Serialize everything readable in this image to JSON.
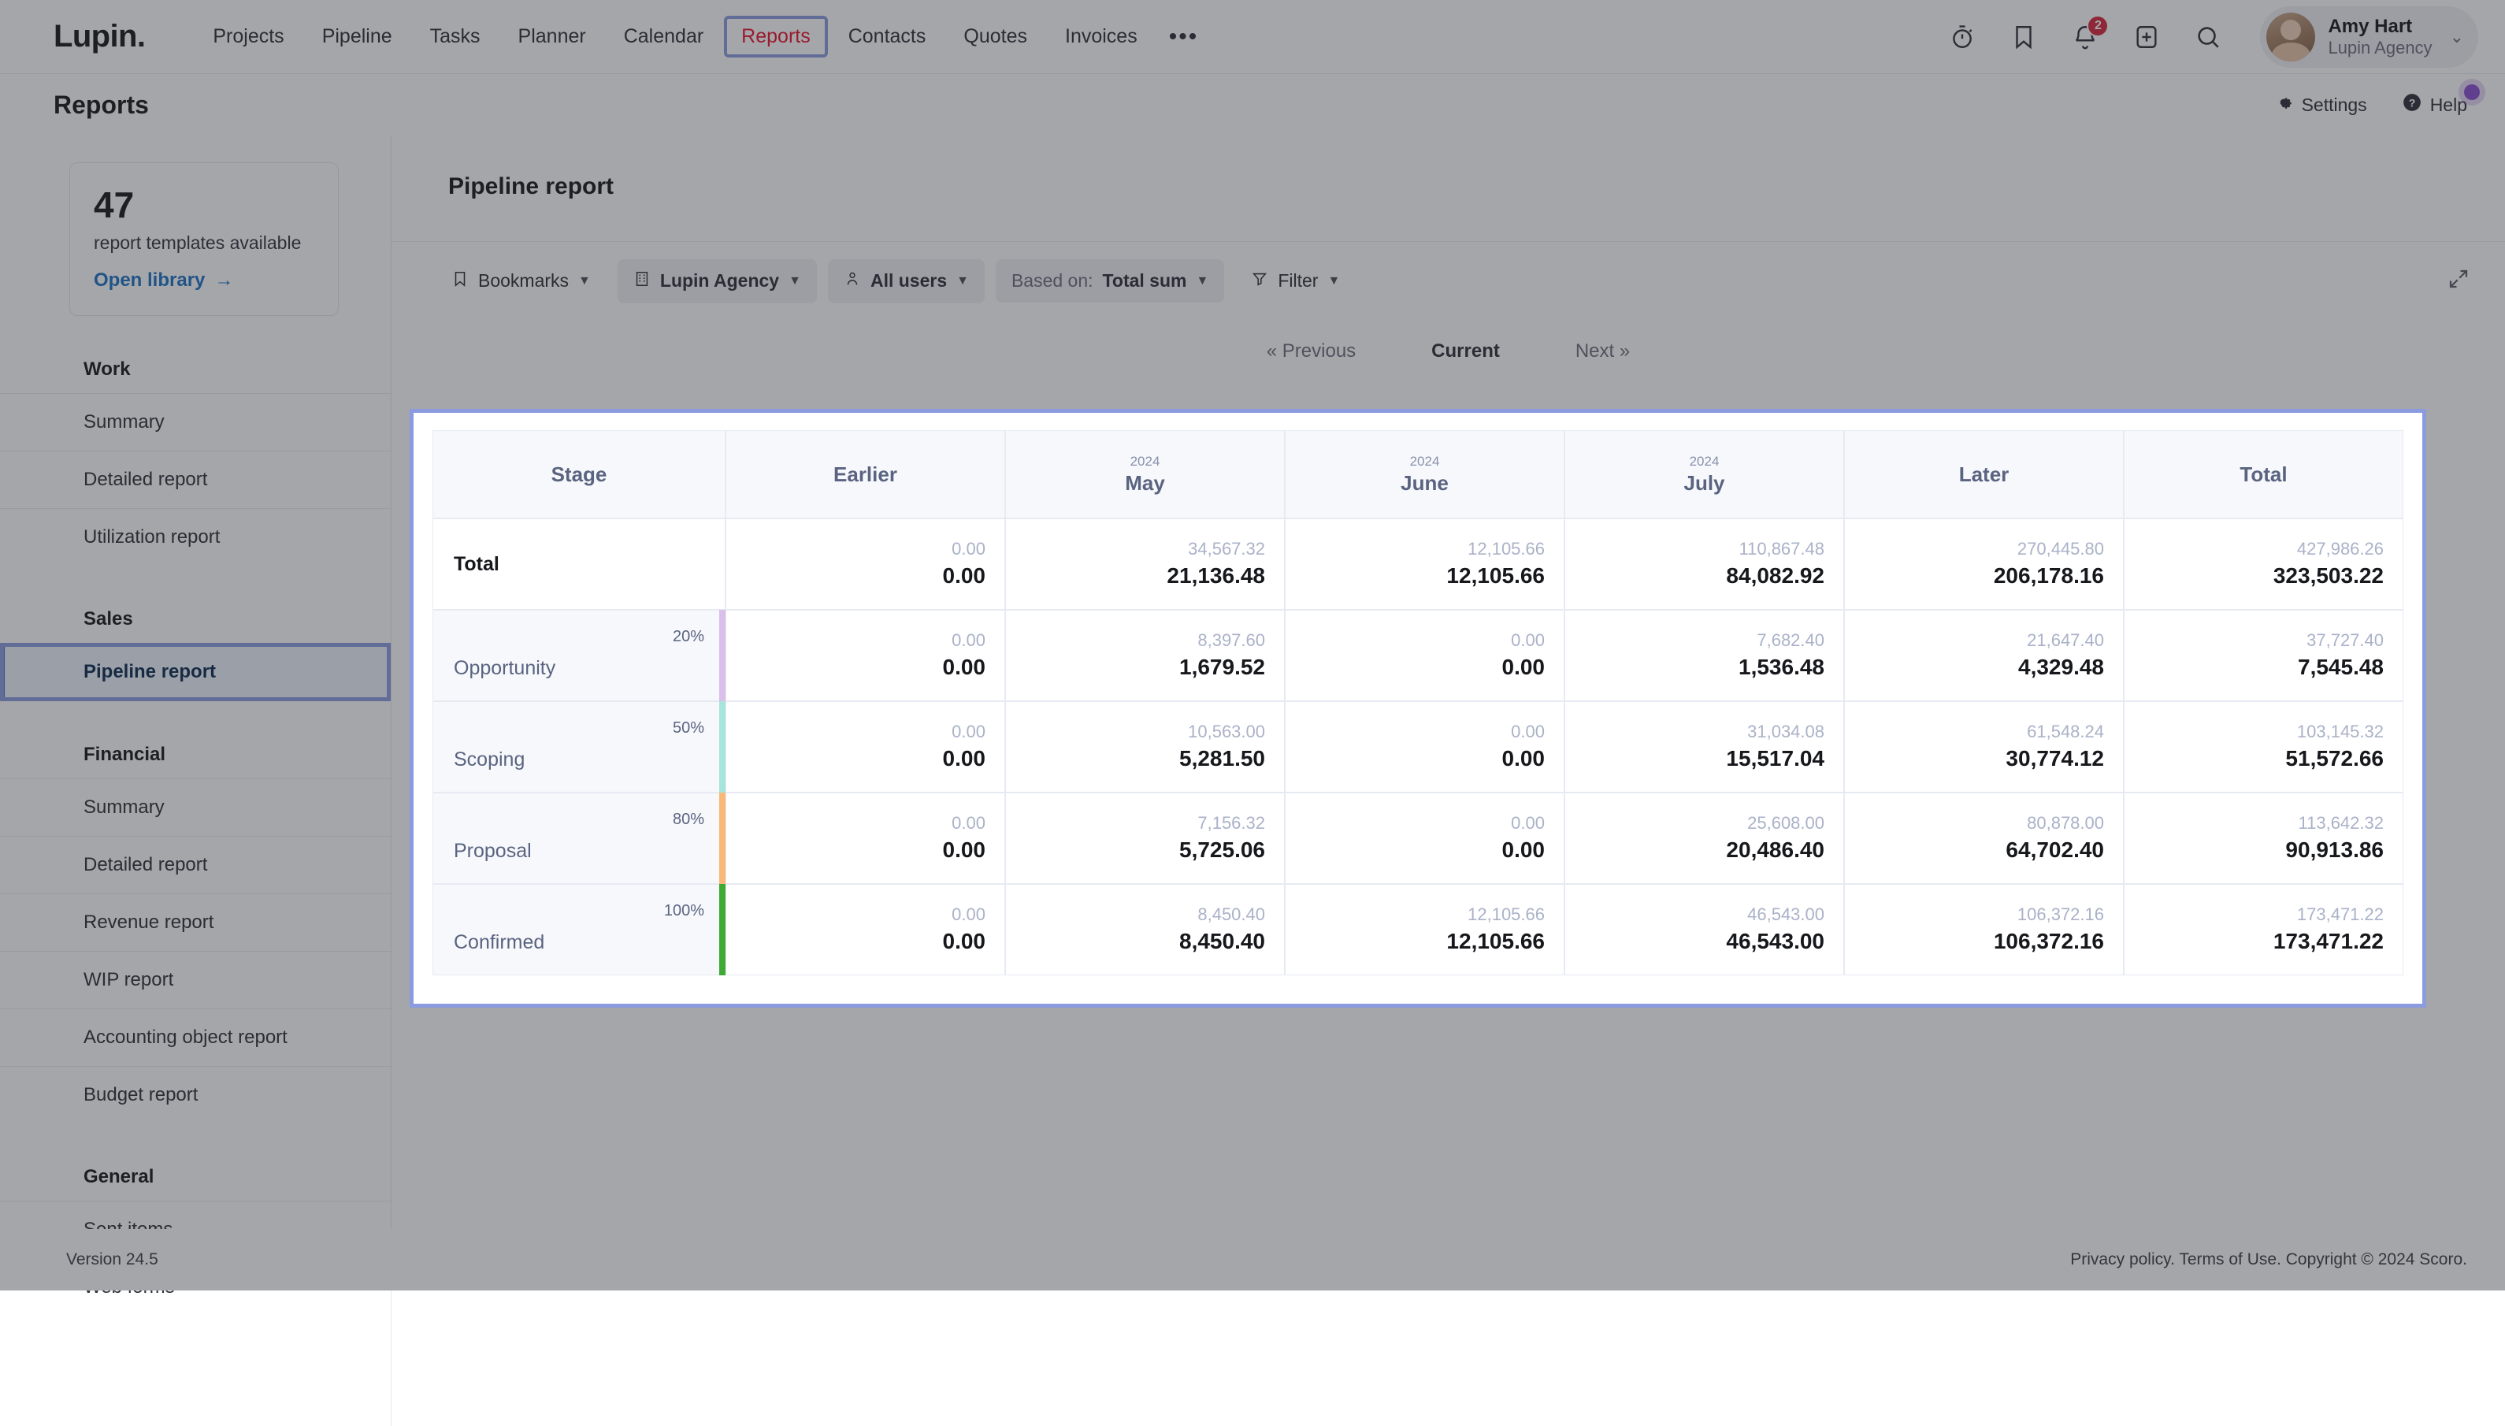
{
  "brand": "Lupin.",
  "topnav": {
    "items": [
      {
        "label": "Projects",
        "active": false
      },
      {
        "label": "Pipeline",
        "active": false
      },
      {
        "label": "Tasks",
        "active": false
      },
      {
        "label": "Planner",
        "active": false
      },
      {
        "label": "Calendar",
        "active": false
      },
      {
        "label": "Reports",
        "active": true
      },
      {
        "label": "Contacts",
        "active": false
      },
      {
        "label": "Quotes",
        "active": false
      },
      {
        "label": "Invoices",
        "active": false
      }
    ],
    "more_label": "•••",
    "icons": [
      "timer-icon",
      "bookmark-icon",
      "bell-icon",
      "add-icon",
      "search-icon"
    ],
    "notification_count": "2",
    "user": {
      "name": "Amy Hart",
      "org": "Lupin Agency"
    }
  },
  "pagehead": {
    "title": "Reports",
    "settings_label": "Settings",
    "help_label": "Help"
  },
  "sidebar": {
    "template_count": "47",
    "template_caption": "report templates available",
    "library_link": "Open library",
    "groups": [
      {
        "label": "Work",
        "items": [
          {
            "label": "Summary",
            "active": false
          },
          {
            "label": "Detailed report",
            "active": false
          },
          {
            "label": "Utilization report",
            "active": false
          }
        ]
      },
      {
        "label": "Sales",
        "items": [
          {
            "label": "Pipeline report",
            "active": true
          }
        ]
      },
      {
        "label": "Financial",
        "items": [
          {
            "label": "Summary",
            "active": false
          },
          {
            "label": "Detailed report",
            "active": false
          },
          {
            "label": "Revenue report",
            "active": false
          },
          {
            "label": "WIP report",
            "active": false
          },
          {
            "label": "Accounting object report",
            "active": false
          },
          {
            "label": "Budget report",
            "active": false
          }
        ]
      },
      {
        "label": "General",
        "items": [
          {
            "label": "Sent items",
            "active": false
          },
          {
            "label": "Web forms",
            "active": false
          }
        ]
      }
    ]
  },
  "main": {
    "title": "Pipeline report",
    "toolbar": {
      "bookmarks": "Bookmarks",
      "company": "Lupin Agency",
      "users": "All users",
      "based_on_prefix": "Based on:",
      "based_on_value": "Total sum",
      "filter": "Filter"
    },
    "pager": {
      "previous": "« Previous",
      "current": "Current",
      "next": "Next »"
    }
  },
  "chart_data": {
    "type": "table",
    "title": "Pipeline report",
    "columns": [
      {
        "key": "stage",
        "label": "Stage",
        "year": ""
      },
      {
        "key": "earlier",
        "label": "Earlier",
        "year": ""
      },
      {
        "key": "may",
        "label": "May",
        "year": "2024"
      },
      {
        "key": "june",
        "label": "June",
        "year": "2024"
      },
      {
        "key": "july",
        "label": "July",
        "year": "2024"
      },
      {
        "key": "later",
        "label": "Later",
        "year": ""
      },
      {
        "key": "total",
        "label": "Total",
        "year": ""
      }
    ],
    "total_row": {
      "label": "Total",
      "cells": [
        {
          "gross": "0.00",
          "weighted": "0.00"
        },
        {
          "gross": "34,567.32",
          "weighted": "21,136.48"
        },
        {
          "gross": "12,105.66",
          "weighted": "12,105.66"
        },
        {
          "gross": "110,867.48",
          "weighted": "84,082.92"
        },
        {
          "gross": "270,445.80",
          "weighted": "206,178.16"
        },
        {
          "gross": "427,986.26",
          "weighted": "323,503.22"
        }
      ]
    },
    "rows": [
      {
        "stage": "Opportunity",
        "probability": "20%",
        "color": "#d9bfe9",
        "cells": [
          {
            "gross": "0.00",
            "weighted": "0.00"
          },
          {
            "gross": "8,397.60",
            "weighted": "1,679.52"
          },
          {
            "gross": "0.00",
            "weighted": "0.00"
          },
          {
            "gross": "7,682.40",
            "weighted": "1,536.48"
          },
          {
            "gross": "21,647.40",
            "weighted": "4,329.48"
          },
          {
            "gross": "37,727.40",
            "weighted": "7,545.48"
          }
        ]
      },
      {
        "stage": "Scoping",
        "probability": "50%",
        "color": "#a7e5dc",
        "cells": [
          {
            "gross": "0.00",
            "weighted": "0.00"
          },
          {
            "gross": "10,563.00",
            "weighted": "5,281.50"
          },
          {
            "gross": "0.00",
            "weighted": "0.00"
          },
          {
            "gross": "31,034.08",
            "weighted": "15,517.04"
          },
          {
            "gross": "61,548.24",
            "weighted": "30,774.12"
          },
          {
            "gross": "103,145.32",
            "weighted": "51,572.66"
          }
        ]
      },
      {
        "stage": "Proposal",
        "probability": "80%",
        "color": "#f9b878",
        "cells": [
          {
            "gross": "0.00",
            "weighted": "0.00"
          },
          {
            "gross": "7,156.32",
            "weighted": "5,725.06"
          },
          {
            "gross": "0.00",
            "weighted": "0.00"
          },
          {
            "gross": "25,608.00",
            "weighted": "20,486.40"
          },
          {
            "gross": "80,878.00",
            "weighted": "64,702.40"
          },
          {
            "gross": "113,642.32",
            "weighted": "90,913.86"
          }
        ]
      },
      {
        "stage": "Confirmed",
        "probability": "100%",
        "color": "#3eaa34",
        "cells": [
          {
            "gross": "0.00",
            "weighted": "0.00"
          },
          {
            "gross": "8,450.40",
            "weighted": "8,450.40"
          },
          {
            "gross": "12,105.66",
            "weighted": "12,105.66"
          },
          {
            "gross": "46,543.00",
            "weighted": "46,543.00"
          },
          {
            "gross": "106,372.16",
            "weighted": "106,372.16"
          },
          {
            "gross": "173,471.22",
            "weighted": "173,471.22"
          }
        ]
      }
    ]
  },
  "footer": {
    "version": "Version 24.5",
    "legal": "Privacy policy. Terms of Use. Copyright © 2024 Scoro."
  }
}
